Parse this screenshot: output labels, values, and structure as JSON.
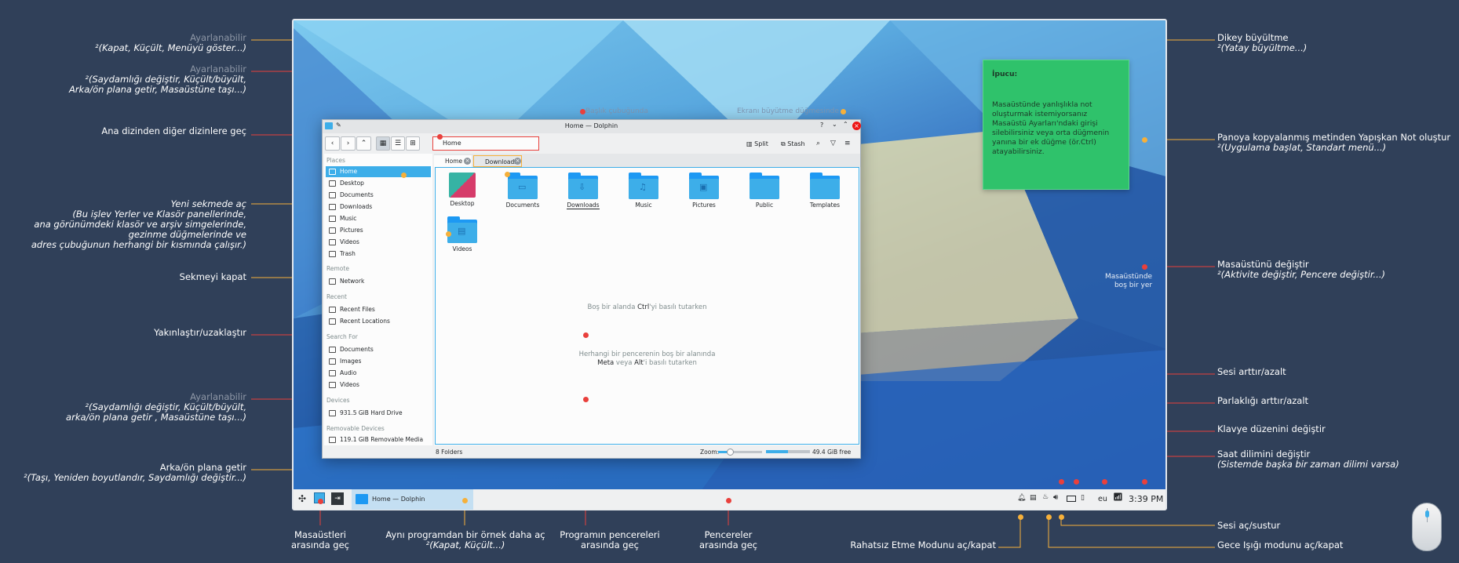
{
  "desktop": {
    "empty_area_label": [
      "Masaüstünde",
      "boş bir yer"
    ],
    "titlebar_hint": "Başlık çubuğunda",
    "maximize_hint": "Ekranı büyütme düğmesinde",
    "zoom_hint": [
      "Boş bir alanda ",
      "Ctrl",
      "'yi basılı tutarken"
    ],
    "move_hint": [
      "Herhangi bir pencerenin boş bir alanında",
      "Meta",
      " veya ",
      "Alt",
      "'i basılı tutarken"
    ]
  },
  "note": {
    "title": "İpucu:",
    "body": "Masaüstünde yanlışlıkla not oluşturmak istemiyorsanız Masaüstü Ayarları'ndaki girişi silebilirsiniz veya orta düğmenin yanına bir ek düğme (ör.Ctrl) atayabilirsiniz."
  },
  "window": {
    "title": "Home — Dolphin",
    "help": "?",
    "address": "Home",
    "split_label": "Split",
    "stash_label": "Stash",
    "tabs": [
      "Home",
      "Downloads"
    ],
    "status_count": "8 Folders",
    "zoom_label": "Zoom:",
    "free_space": "49.4 GiB free",
    "sidebar": {
      "places_header": "Places",
      "places": [
        "Home",
        "Desktop",
        "Documents",
        "Downloads",
        "Music",
        "Pictures",
        "Videos",
        "Trash"
      ],
      "remote_header": "Remote",
      "remote": [
        "Network"
      ],
      "recent_header": "Recent",
      "recent": [
        "Recent Files",
        "Recent Locations"
      ],
      "search_header": "Search For",
      "search": [
        "Documents",
        "Images",
        "Audio",
        "Videos"
      ],
      "devices_header": "Devices",
      "devices": [
        "931.5 GiB Hard Drive"
      ],
      "removable_header": "Removable Devices",
      "removable": [
        "119.1 GiB Removable Media"
      ]
    },
    "folders": [
      "Desktop",
      "Documents",
      "Downloads",
      "Music",
      "Pictures",
      "Public",
      "Templates",
      "Videos"
    ]
  },
  "panel": {
    "task_title": "Home — Dolphin",
    "keyboard_layout": "eu",
    "clock": "3:39 PM"
  },
  "annotations": {
    "a1": {
      "gray": "Ayarlanabilir",
      "it": "²(Kapat, Küçült, Menüyü göster...)"
    },
    "a2": {
      "gray": "Ayarlanabilir",
      "it1": "²(Saydamlığı değiştir, Küçült/büyült,",
      "it2": "Arka/ön plana getir, Masaüstüne taşı...)"
    },
    "a3": "Ana dizinden diğer dizinlere geç",
    "a4": {
      "pl": "Yeni sekmede aç",
      "l1": "(Bu işlev Yerler ve Klasör panellerinde,",
      "l2": "ana görünümdeki klasör ve arşiv simgelerinde,",
      "l3": "gezinme düğmelerinde ve",
      "l4": "adres çubuğunun herhangi bir kısmında çalışır.)"
    },
    "a5": "Sekmeyi kapat",
    "a6": "Yakınlaştır/uzaklaştır",
    "a7": {
      "gray": "Ayarlanabilir",
      "it1": "²(Saydamlığı değiştir, Küçült/büyült,",
      "it2": "arka/ön plana getir , Masaüstüne taşı...)"
    },
    "a8": {
      "pl": "Arka/ön plana getir",
      "it": "²(Taşı, Yeniden boyutlandır, Saydamlığı değiştir...)"
    },
    "b1": {
      "pl": "Masaüstleri",
      "pl2": "arasında geç"
    },
    "b2": {
      "pl": "Aynı programdan bir örnek daha aç",
      "it": "²(Kapat, Küçült...)"
    },
    "b3": {
      "pl": "Programın pencereleri",
      "pl2": "arasında geç"
    },
    "b4": {
      "pl": "Pencereler",
      "pl2": "arasında geç"
    },
    "b5": "Rahatsız Etme Modunu aç/kapat",
    "r1": {
      "pl": "Dikey büyültme",
      "it": "²(Yatay büyültme...)"
    },
    "r2": {
      "pl": "Panoya kopyalanmış metinden Yapışkan Not oluştur",
      "it": "²(Uygulama başlat, Standart menü...)"
    },
    "r3": {
      "pl": "Masaüstünü değiştir",
      "it": "²(Aktivite değiştir, Pencere değiştir...)"
    },
    "r4": "Sesi arttır/azalt",
    "r5": "Parlaklığı arttır/azalt",
    "r6": "Klavye düzenini değiştir",
    "r7": {
      "pl": "Saat dilimini değiştir",
      "it": "(Sistemde başka bir zaman dilimi varsa)"
    },
    "r8": "Sesi aç/sustur",
    "r9": "Gece Işığı modunu aç/kapat"
  },
  "colors": {
    "background": "#304059",
    "accent": "#3daee9",
    "red_dot": "#e9403c",
    "orange_dot": "#f6b03a",
    "note": "#2fc26b"
  }
}
